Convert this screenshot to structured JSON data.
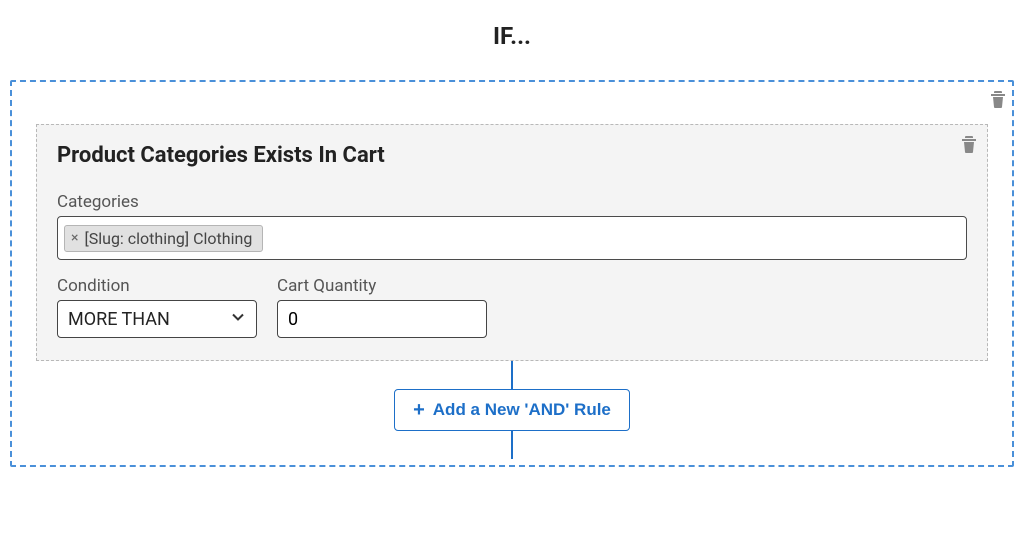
{
  "heading": "IF...",
  "rule": {
    "title": "Product Categories Exists In Cart",
    "categories_label": "Categories",
    "tags": [
      {
        "label": "[Slug: clothing] Clothing"
      }
    ],
    "condition_label": "Condition",
    "condition_value": "MORE THAN",
    "quantity_label": "Cart Quantity",
    "quantity_value": "0"
  },
  "add_and_label": "Add a New 'AND' Rule"
}
